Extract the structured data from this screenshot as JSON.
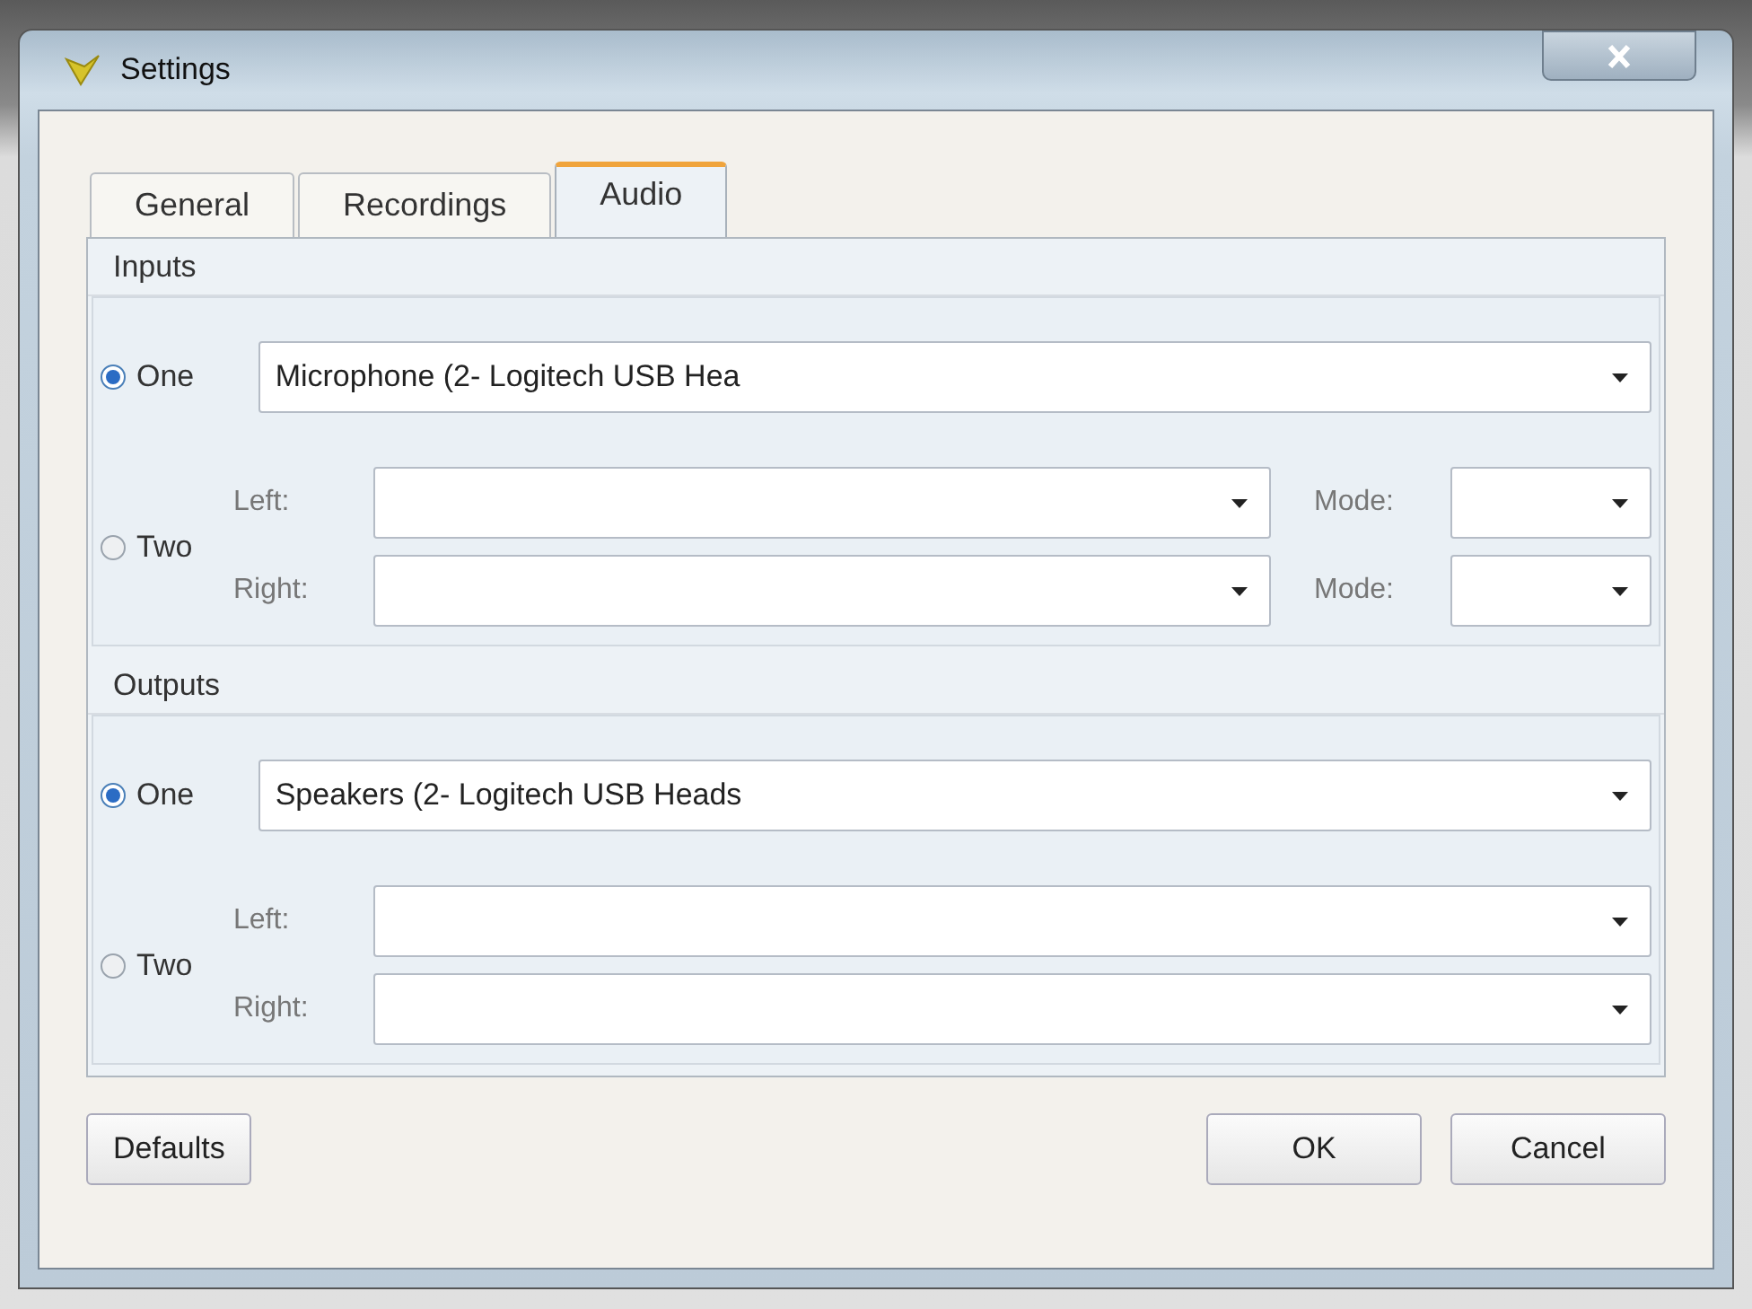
{
  "window": {
    "title": "Settings"
  },
  "tabs": [
    {
      "label": "General",
      "selected": false
    },
    {
      "label": "Recordings",
      "selected": false
    },
    {
      "label": "Audio",
      "selected": true
    }
  ],
  "inputs": {
    "title": "Inputs",
    "one": {
      "label": "One",
      "selected": true,
      "value": "Microphone (2- Logitech USB Hea"
    },
    "two": {
      "label": "Two",
      "selected": false,
      "channels": [
        {
          "label": "Left:",
          "mode_label": "Mode:"
        },
        {
          "label": "Right:",
          "mode_label": "Mode:"
        }
      ]
    }
  },
  "outputs": {
    "title": "Outputs",
    "one": {
      "label": "One",
      "selected": true,
      "value": "Speakers (2- Logitech USB Heads"
    },
    "two": {
      "label": "Two",
      "selected": false,
      "channels": [
        {
          "label": "Left:"
        },
        {
          "label": "Right:"
        }
      ]
    }
  },
  "buttons": {
    "defaults": "Defaults",
    "ok": "OK",
    "cancel": "Cancel"
  }
}
